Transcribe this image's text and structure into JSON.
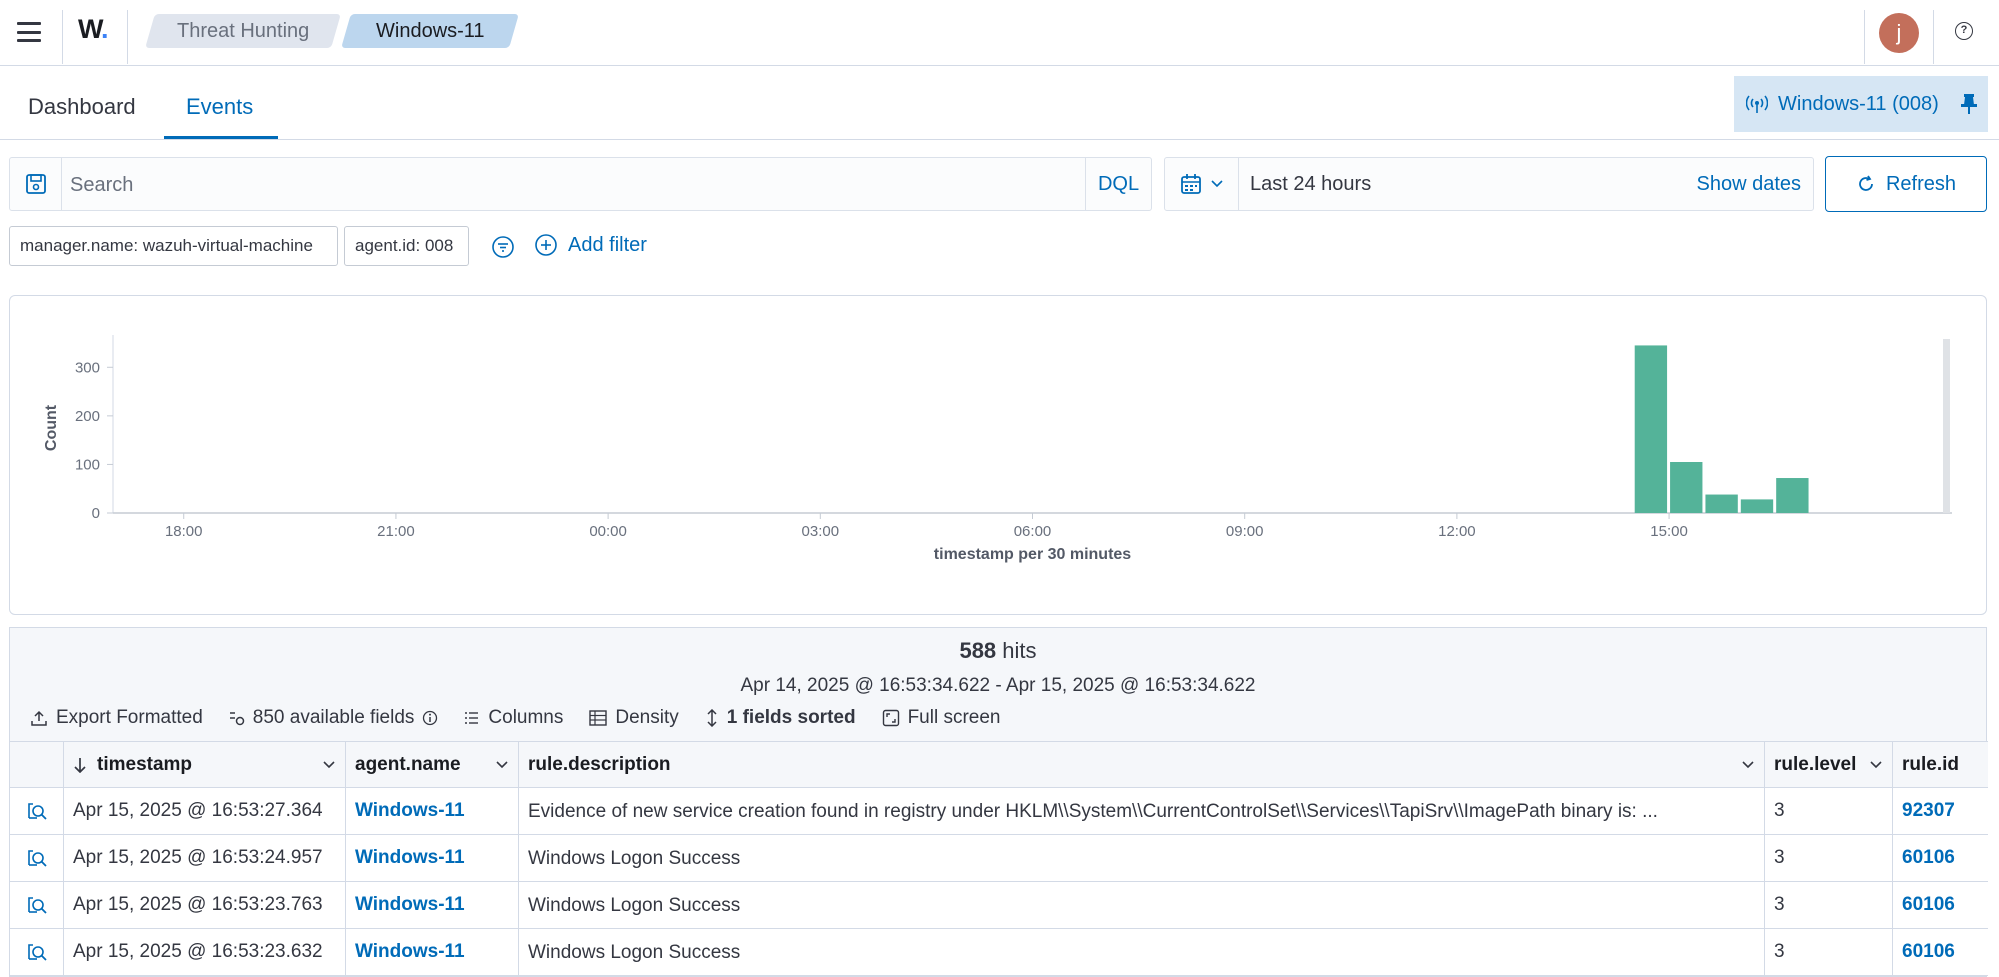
{
  "header": {
    "logo": "W",
    "breadcrumbs": [
      "Threat Hunting",
      "Windows-11"
    ],
    "avatar_initial": "j",
    "help_icon": "?"
  },
  "tabs": [
    {
      "label": "Dashboard",
      "active": false
    },
    {
      "label": "Events",
      "active": true
    }
  ],
  "pinned_agent": {
    "label": "Windows-11 (008)"
  },
  "search": {
    "placeholder": "Search",
    "language": "DQL"
  },
  "date_picker": {
    "range": "Last 24 hours",
    "show_dates_label": "Show dates",
    "refresh_label": "Refresh"
  },
  "filters": [
    "manager.name: wazuh-virtual-machine",
    "agent.id: 008"
  ],
  "add_filter_label": "Add filter",
  "chart_data": {
    "type": "bar",
    "x_ticks": [
      "18:00",
      "21:00",
      "00:00",
      "03:00",
      "06:00",
      "09:00",
      "12:00",
      "15:00"
    ],
    "y_ticks": [
      0,
      100,
      200,
      300
    ],
    "ylim": [
      0,
      350
    ],
    "ylabel": "Count",
    "xlabel": "timestamp per 30 minutes",
    "bars": [
      {
        "x": "14:30",
        "value": 345
      },
      {
        "x": "15:00",
        "value": 105
      },
      {
        "x": "15:30",
        "value": 38
      },
      {
        "x": "16:00",
        "value": 28
      },
      {
        "x": "16:30",
        "value": 72
      }
    ],
    "bar_color": "#54b399"
  },
  "results": {
    "hits_count": "588",
    "hits_label": "hits",
    "range": "Apr 14, 2025 @ 16:53:34.622 - Apr 15, 2025 @ 16:53:34.622",
    "toolbar": {
      "export": "Export Formatted",
      "fields": "850 available fields",
      "columns": "Columns",
      "density": "Density",
      "sorted": "1 fields sorted",
      "fullscreen": "Full screen"
    },
    "columns": [
      "timestamp",
      "agent.name",
      "rule.description",
      "rule.level",
      "rule.id"
    ],
    "rows": [
      {
        "timestamp": "Apr 15, 2025 @ 16:53:27.364",
        "agent": "Windows-11",
        "description": "Evidence of new service creation found in registry under HKLM\\\\System\\\\CurrentControlSet\\\\Services\\\\TapiSrv\\\\ImagePath binary is: ...",
        "level": "3",
        "rule_id": "92307"
      },
      {
        "timestamp": "Apr 15, 2025 @ 16:53:24.957",
        "agent": "Windows-11",
        "description": "Windows Logon Success",
        "level": "3",
        "rule_id": "60106"
      },
      {
        "timestamp": "Apr 15, 2025 @ 16:53:23.763",
        "agent": "Windows-11",
        "description": "Windows Logon Success",
        "level": "3",
        "rule_id": "60106"
      },
      {
        "timestamp": "Apr 15, 2025 @ 16:53:23.632",
        "agent": "Windows-11",
        "description": "Windows Logon Success",
        "level": "3",
        "rule_id": "60106"
      }
    ]
  }
}
